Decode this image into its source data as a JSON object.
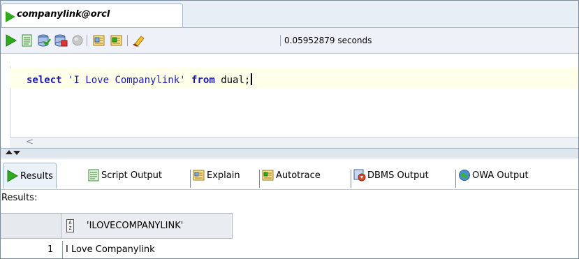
{
  "window": {
    "connection_tab": "companylink@orcl"
  },
  "toolbar": {
    "icons": [
      "run-statement-icon",
      "run-script-icon",
      "commit-icon",
      "rollback-icon",
      "cancel-icon",
      "sql-history-icon",
      "explain-plan-icon",
      "clear-icon"
    ],
    "timing": "0.05952879 seconds"
  },
  "editor": {
    "tokens": {
      "select_kw": "select",
      "string_literal": "'I Love Companylink'",
      "from_kw": "from",
      "table": "dual;"
    },
    "hscroll_arrow": "<"
  },
  "output_tabs": [
    {
      "label": "Results",
      "icon": "play-icon",
      "active": true
    },
    {
      "label": "Script Output",
      "icon": "script-output-icon"
    },
    {
      "label": "Explain",
      "icon": "explain-icon"
    },
    {
      "label": "Autotrace",
      "icon": "autotrace-icon"
    },
    {
      "label": "DBMS Output",
      "icon": "dbms-output-icon"
    },
    {
      "label": "OWA Output",
      "icon": "owa-output-icon"
    }
  ],
  "results": {
    "label": "Results:",
    "column_type_icon_text": "A\nZ",
    "columns": [
      "'ILOVECOMPANYLINK'"
    ],
    "rows": [
      {
        "num": "1",
        "values": [
          "I Love Companylink"
        ]
      }
    ]
  },
  "colors": {
    "run_green": "#2faa1f",
    "keyword_blue": "#1a1ab3",
    "current_line": "#ffffea"
  }
}
